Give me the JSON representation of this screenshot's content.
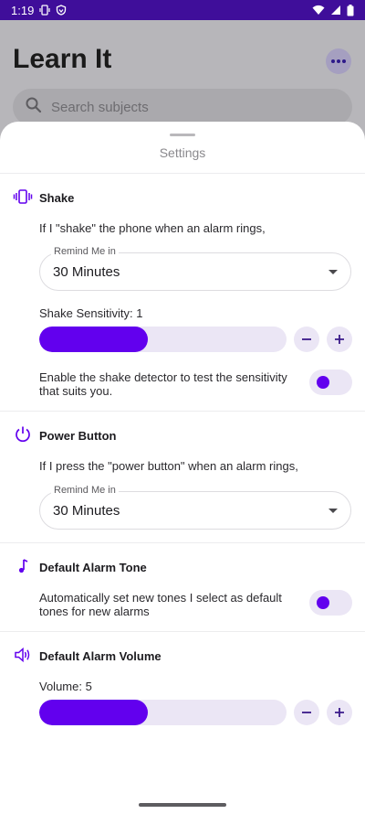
{
  "status_bar": {
    "time": "1:19"
  },
  "app": {
    "title": "Learn It",
    "search": {
      "placeholder": "Search subjects"
    }
  },
  "sheet": {
    "title": "Settings"
  },
  "shake": {
    "title": "Shake",
    "description": "If I \"shake\" the phone when an alarm rings,",
    "remind_label": "Remind Me in",
    "remind_value": "30 Minutes",
    "sensitivity_label": "Shake Sensitivity: 1",
    "sensitivity_fraction": 0.44,
    "detector_text_line1": "Enable the shake detector to test the sensitivity",
    "detector_text_line2": "that suits you.",
    "detector_enabled": false
  },
  "power_button": {
    "title": "Power Button",
    "description": "If I press the \"power button\" when an alarm rings,",
    "remind_label": "Remind Me in",
    "remind_value": "30 Minutes"
  },
  "alarm_tone": {
    "title": "Default Alarm Tone",
    "text_line1": "Automatically set new tones I select as default",
    "text_line2": "tones for new alarms",
    "enabled": false
  },
  "alarm_volume": {
    "title": "Default Alarm Volume",
    "volume_label": "Volume: 5",
    "volume_fraction": 0.44
  },
  "colors": {
    "accent": "#6200ee",
    "status_bar": "#3f0e9a",
    "track": "#ebe6f5"
  },
  "icons": [
    "vibration-icon",
    "power-icon",
    "music-note-icon",
    "volume-icon",
    "search-icon",
    "more-icon",
    "minus-icon",
    "plus-icon"
  ]
}
